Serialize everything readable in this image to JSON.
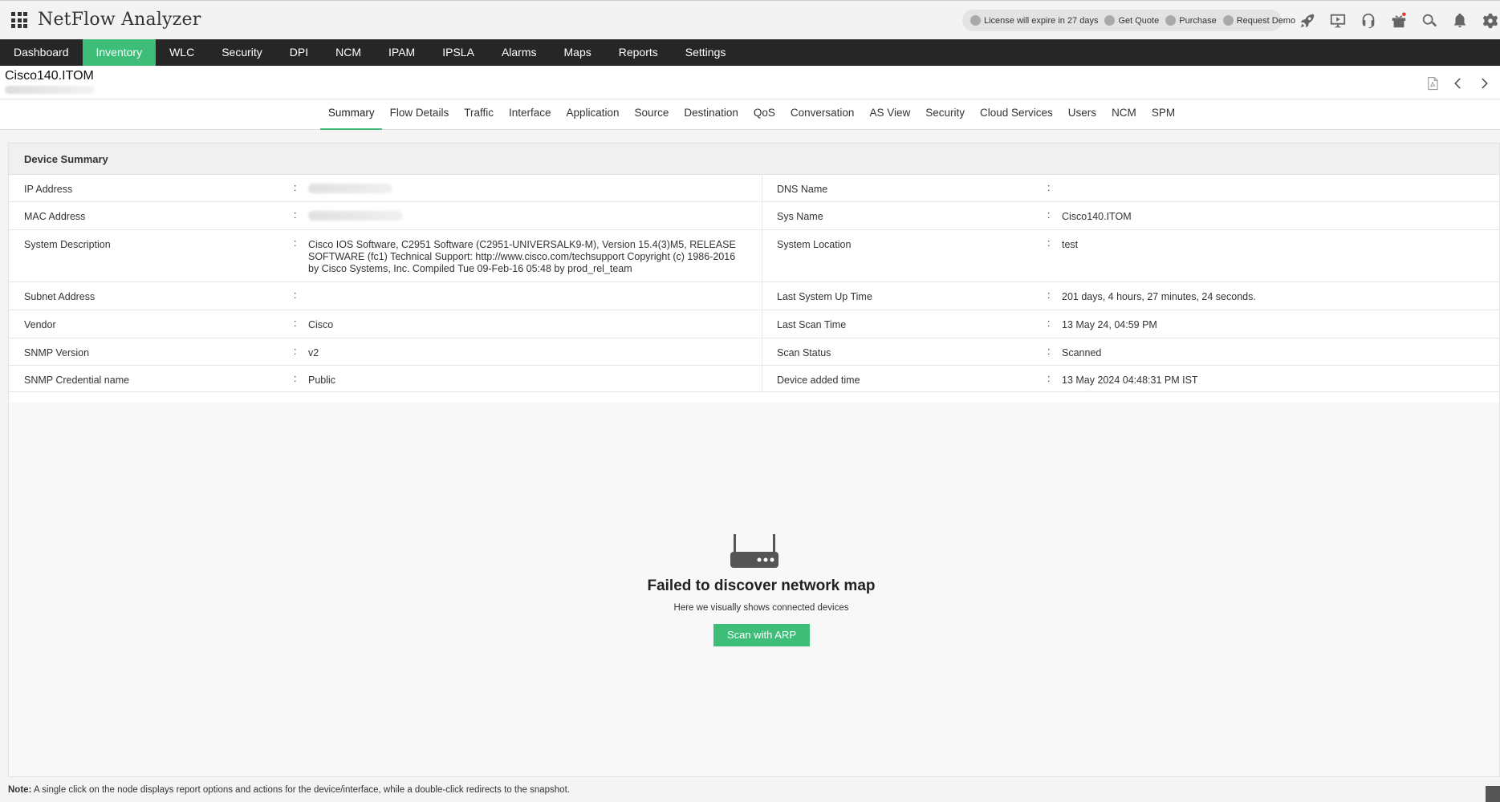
{
  "header": {
    "app_title": "NetFlow Analyzer",
    "promo": [
      {
        "icon": "license-icon",
        "label": "License will expire in 27 days"
      },
      {
        "icon": "dollar-icon",
        "label": "Get Quote"
      },
      {
        "icon": "cart-icon",
        "label": "Purchase"
      },
      {
        "icon": "demo-icon",
        "label": "Request Demo"
      }
    ],
    "tools": [
      "rocket-icon",
      "presentation-icon",
      "headset-icon",
      "gift-icon",
      "search-icon",
      "bell-icon",
      "gear-icon"
    ]
  },
  "nav": {
    "items": [
      "Dashboard",
      "Inventory",
      "WLC",
      "Security",
      "DPI",
      "NCM",
      "IPAM",
      "IPSLA",
      "Alarms",
      "Maps",
      "Reports",
      "Settings"
    ],
    "active": "Inventory"
  },
  "device": {
    "name": "Cisco140.ITOM"
  },
  "tabs": {
    "items": [
      "Summary",
      "Flow Details",
      "Traffic",
      "Interface",
      "Application",
      "Source",
      "Destination",
      "QoS",
      "Conversation",
      "AS View",
      "Security",
      "Cloud Services",
      "Users",
      "NCM",
      "SPM"
    ],
    "active": "Summary"
  },
  "summary": {
    "title": "Device Summary",
    "rows": [
      {
        "left_label": "IP Address",
        "left_value": "",
        "right_label": "DNS Name",
        "right_value": ""
      },
      {
        "left_label": "MAC Address",
        "left_value": "",
        "right_label": "Sys Name",
        "right_value": "Cisco140.ITOM"
      },
      {
        "left_label": "System Description",
        "left_value": "Cisco IOS Software, C2951 Software (C2951-UNIVERSALK9-M), Version 15.4(3)M5, RELEASE SOFTWARE (fc1) Technical Support: http://www.cisco.com/techsupport Copyright (c) 1986-2016 by Cisco Systems, Inc. Compiled Tue 09-Feb-16 05:48 by prod_rel_team",
        "right_label": "System Location",
        "right_value": "test"
      },
      {
        "left_label": "Subnet Address",
        "left_value": "",
        "right_label": "Last System Up Time",
        "right_value": "201 days, 4 hours, 27 minutes, 24 seconds."
      },
      {
        "left_label": "Vendor",
        "left_value": "Cisco",
        "right_label": "Last Scan Time",
        "right_value": "13 May 24, 04:59 PM"
      },
      {
        "left_label": "SNMP Version",
        "left_value": "v2",
        "right_label": "Scan Status",
        "right_value": "Scanned"
      },
      {
        "left_label": "SNMP Credential name",
        "left_value": "Public",
        "right_label": "Device added time",
        "right_value": "13 May 2024 04:48:31 PM IST"
      }
    ]
  },
  "map": {
    "title": "Failed to discover network map",
    "subtitle": "Here we visually shows connected devices",
    "button": "Scan with ARP"
  },
  "note": {
    "label": "Note:",
    "text": " A single click on the node displays report options and actions for the device/interface, while a double-click redirects to the snapshot."
  },
  "colors": {
    "accent": "#3dbd77",
    "nav_bg": "#262626"
  }
}
